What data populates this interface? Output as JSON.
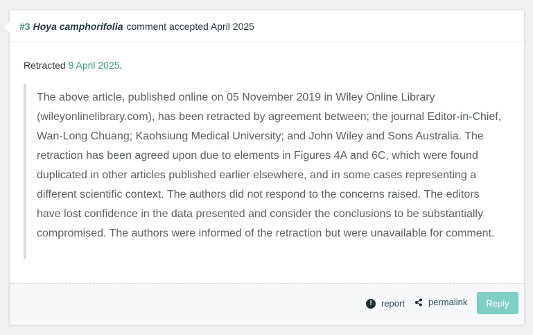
{
  "header": {
    "number": "#3",
    "species": "Hoya camphorifolia",
    "status_text": "comment accepted April 2025"
  },
  "retraction": {
    "prefix": "Retracted",
    "date": "9 April 2025",
    "suffix": ".",
    "notice": "The above article, published online on 05 November 2019 in Wiley Online Library (wileyonlinelibrary.com), has been retracted by agreement between; the journal Editor-in-Chief, Wan-Long Chuang; Kaohsiung Medical University; and John Wiley and Sons Australia. The retraction has been agreed upon due to elements in Figures 4A and 6C, which were found duplicated in other articles published earlier elsewhere, and in some cases representing a different scientific context. The authors did not respond to the concerns raised. The editors have lost confidence in the data presented and consider the conclusions to be substantially compromised. The authors were informed of the retraction but were unavailable for comment."
  },
  "footer": {
    "report_label": "report",
    "report_icon": "!",
    "permalink_label": "permalink",
    "reply_label": "Reply"
  },
  "colors": {
    "accent_green": "#3a9a74",
    "reply_button": "#7fcfc5"
  }
}
